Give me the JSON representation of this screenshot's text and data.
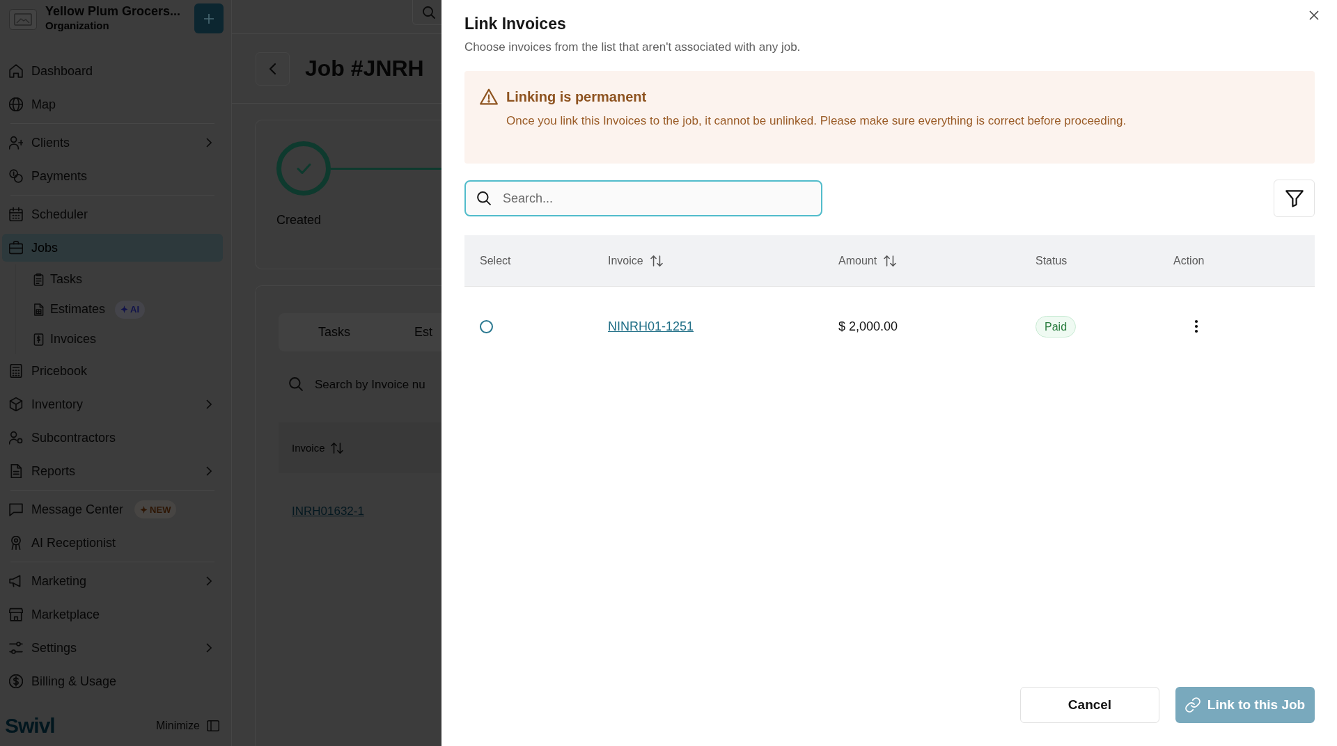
{
  "sidebar": {
    "org_name": "Yellow Plum Grocers...",
    "org_type": "Organization",
    "sections": [
      {
        "items": [
          {
            "label": "Dashboard",
            "selected": false,
            "chevron": false
          },
          {
            "label": "Map",
            "selected": false,
            "chevron": false
          }
        ]
      },
      {
        "items": [
          {
            "label": "Clients",
            "selected": false,
            "chevron": true
          },
          {
            "label": "Payments",
            "selected": false,
            "chevron": false
          }
        ]
      },
      {
        "items": [
          {
            "label": "Scheduler",
            "selected": false,
            "chevron": false
          },
          {
            "label": "Jobs",
            "selected": true,
            "chevron": false,
            "children": [
              {
                "label": "Tasks",
                "selected": false
              },
              {
                "label": "Estimates",
                "selected": false,
                "badge": {
                  "label": "AI",
                  "color": "#10124a"
                }
              },
              {
                "label": "Invoices",
                "selected": false
              }
            ]
          },
          {
            "label": "Pricebook",
            "selected": false,
            "chevron": false
          },
          {
            "label": "Inventory",
            "selected": false,
            "chevron": true
          },
          {
            "label": "Subcontractors",
            "selected": false,
            "chevron": false
          },
          {
            "label": "Reports",
            "selected": false,
            "chevron": true
          }
        ]
      },
      {
        "items": [
          {
            "label": "Message Center",
            "selected": false,
            "chevron": false,
            "badge": {
              "label": "NEW",
              "color": "#2e1604"
            }
          },
          {
            "label": "AI Receptionist",
            "selected": false,
            "chevron": false
          }
        ]
      },
      {
        "items": [
          {
            "label": "Marketing",
            "selected": false,
            "chevron": true
          },
          {
            "label": "Marketplace",
            "selected": false,
            "chevron": false
          },
          {
            "label": "Settings",
            "selected": false,
            "chevron": true
          },
          {
            "label": "Billing & Usage",
            "selected": false,
            "chevron": false
          }
        ]
      }
    ],
    "brand": "Swivl",
    "minimize_label": "Minimize"
  },
  "job_page": {
    "title": "Job #JNRH",
    "progress": {
      "steps": [
        {
          "label": "Created",
          "done": true
        }
      ]
    },
    "tabs": [
      {
        "label": "Tasks",
        "selected": false
      },
      {
        "label": "Est",
        "selected": false
      }
    ],
    "search": {
      "placeholder": "Search by Invoice nu"
    },
    "table": {
      "columns": [
        {
          "label": "Invoice",
          "sortable": true
        }
      ],
      "rows": [
        {
          "invoice": "INRH01632-1"
        }
      ]
    }
  },
  "dialog": {
    "title": "Link Invoices",
    "subtitle": "Choose invoices from the list that aren't associated with any job.",
    "alert": {
      "title": "Linking is permanent",
      "message": "Once you link this Invoices to the job, it cannot be unlinked. Please make sure everything is correct before proceeding."
    },
    "search": {
      "placeholder": "Search...",
      "focused": true
    },
    "table": {
      "columns": [
        {
          "label": "Select",
          "sortable": false
        },
        {
          "label": "Invoice",
          "sortable": true
        },
        {
          "label": "Amount",
          "sortable": true
        },
        {
          "label": "Status",
          "sortable": false
        },
        {
          "label": "Action",
          "sortable": false
        }
      ],
      "rows": [
        {
          "selected": false,
          "invoice": "NINRH01-1251",
          "amount": "$ 2,000.00",
          "status": "Paid"
        }
      ]
    },
    "buttons": [
      {
        "label": "Cancel",
        "kind": "secondary",
        "disabled": false
      },
      {
        "label": "Link to this Job",
        "kind": "primary",
        "disabled": true
      }
    ]
  }
}
